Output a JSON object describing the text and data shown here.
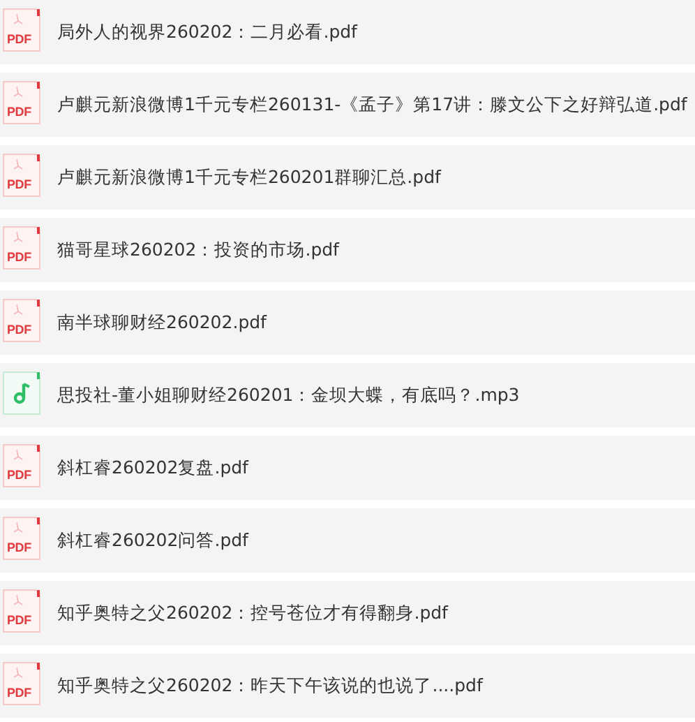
{
  "files": [
    {
      "kind": "pdf",
      "badge": "PDF",
      "name": "局外人的视界260202：二月必看.pdf"
    },
    {
      "kind": "pdf",
      "badge": "PDF",
      "name": "卢麒元新浪微博1千元专栏260131-《孟子》第17讲：滕文公下之好辩弘道.pdf"
    },
    {
      "kind": "pdf",
      "badge": "PDF",
      "name": "卢麒元新浪微博1千元专栏260201群聊汇总.pdf"
    },
    {
      "kind": "pdf",
      "badge": "PDF",
      "name": "猫哥星球260202：投资的市场.pdf"
    },
    {
      "kind": "pdf",
      "badge": "PDF",
      "name": "南半球聊财经260202.pdf"
    },
    {
      "kind": "audio",
      "name": "思投社-董小姐聊财经260201：金坝大蝶，有底吗？.mp3"
    },
    {
      "kind": "pdf",
      "badge": "PDF",
      "name": "斜杠睿260202复盘.pdf"
    },
    {
      "kind": "pdf",
      "badge": "PDF",
      "name": "斜杠睿260202问答.pdf"
    },
    {
      "kind": "pdf",
      "badge": "PDF",
      "name": "知乎奥特之父260202：控号苍位才有得翻身.pdf"
    },
    {
      "kind": "pdf",
      "badge": "PDF",
      "name": "知乎奥特之父260202：昨天下午该说的也说了....pdf"
    }
  ]
}
